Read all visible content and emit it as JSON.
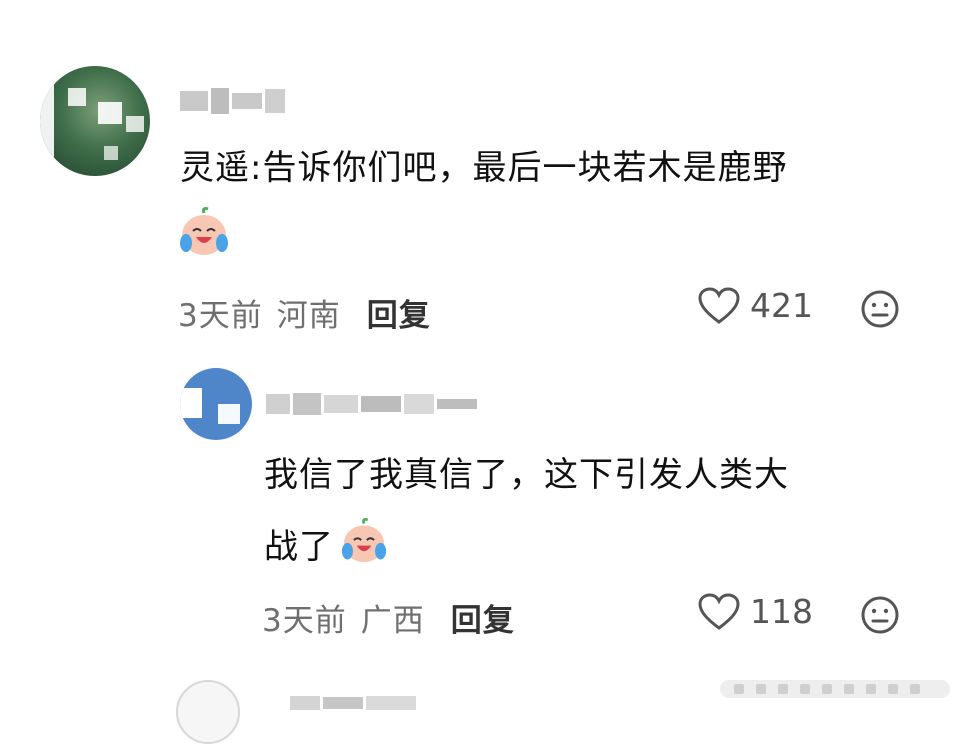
{
  "comments": [
    {
      "text": "灵遥:告诉你们吧，最后一块若木是鹿野",
      "time": "3天前",
      "location": "河南",
      "reply_label": "回复",
      "likes": "421"
    },
    {
      "text_line1": "我信了我真信了，这下引发人类大",
      "text_line2": "战了",
      "time": "3天前",
      "location": "广西",
      "reply_label": "回复",
      "likes": "118"
    }
  ],
  "icons": {
    "like": "heart-outline-icon",
    "reaction": "meh-face-icon",
    "emoji": "crying-laughing-peach-emoji"
  },
  "colors": {
    "meta_text": "#6f6f6f",
    "reply_text": "#333333",
    "avatar_2": "#4f86c9"
  }
}
